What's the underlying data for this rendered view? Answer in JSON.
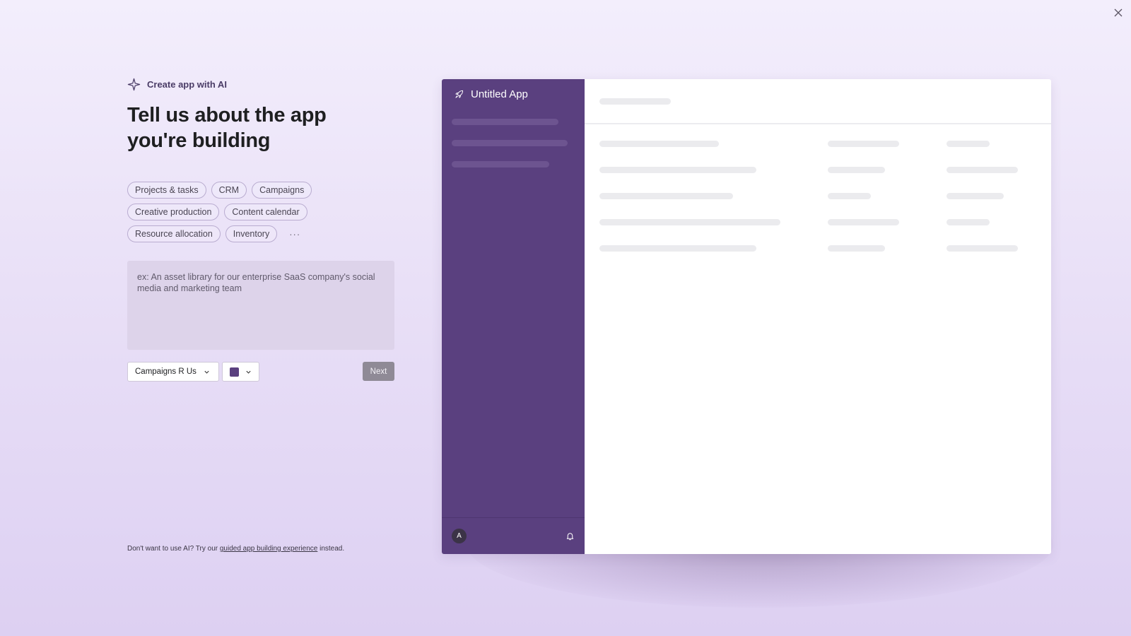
{
  "header": {
    "ai_label": "Create app with AI",
    "title": "Tell us about the app you're building"
  },
  "chips": [
    {
      "label": "Projects & tasks"
    },
    {
      "label": "CRM"
    },
    {
      "label": "Campaigns"
    },
    {
      "label": "Creative production"
    },
    {
      "label": "Content calendar"
    },
    {
      "label": "Resource allocation"
    },
    {
      "label": "Inventory"
    }
  ],
  "more_label": "···",
  "description": {
    "placeholder": "ex: An asset library for our enterprise SaaS company's social media and marketing team",
    "value": ""
  },
  "workspace": {
    "selected": "Campaigns R Us"
  },
  "color": {
    "selected": "#5a407f"
  },
  "next_label": "Next",
  "footer": {
    "prefix": "Don't want to use AI? Try our ",
    "link": "guided app building experience",
    "suffix": " instead."
  },
  "preview": {
    "app_name": "Untitled App",
    "avatar_initial": "A",
    "sidebar_color": "#5a407f"
  }
}
